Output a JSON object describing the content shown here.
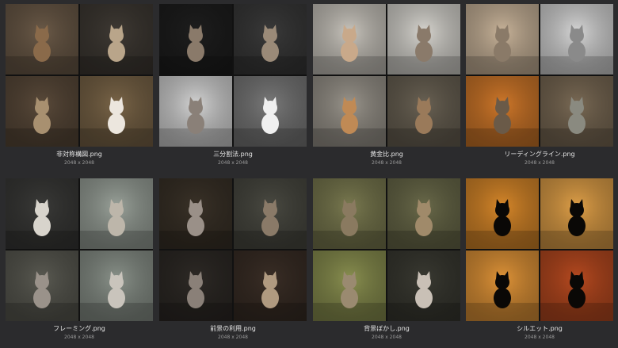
{
  "gallery": {
    "items": [
      {
        "name": "非対称構図.png",
        "dims": "2048 x 2048",
        "palette": [
          "#6b5a48",
          "#3f3a34",
          "#5a4a3a",
          "#7a6548"
        ],
        "cat": [
          "#8a6a4a",
          "#b9a58a",
          "#a89070",
          "#ece6de"
        ]
      },
      {
        "name": "三分割法.png",
        "dims": "2048 x 2048",
        "palette": [
          "#1e1e1e",
          "#3a3a3a",
          "#d4d4d4",
          "#7a7a7a"
        ],
        "cat": [
          "#8a7a6a",
          "#9a8a78",
          "#8a8078",
          "#f0f0f0"
        ]
      },
      {
        "name": "黄金比.png",
        "dims": "2048 x 2048",
        "palette": [
          "#c9c5bd",
          "#d8d6d0",
          "#9a958c",
          "#6a6254"
        ],
        "cat": [
          "#c9a98a",
          "#8a7a6a",
          "#c08a55",
          "#9a7a5a"
        ]
      },
      {
        "name": "リーディングライン.png",
        "dims": "2048 x 2048",
        "palette": [
          "#c9b49a",
          "#d7d7d7",
          "#d0782a",
          "#7a6a55"
        ],
        "cat": [
          "#8a7a68",
          "#8a8a8a",
          "#6a5a48",
          "#8a8a80"
        ]
      },
      {
        "name": "フレーミング.png",
        "dims": "2048 x 2048",
        "palette": [
          "#3a3a38",
          "#9aa29a",
          "#5a5a52",
          "#8a928a"
        ],
        "cat": [
          "#d8d4cc",
          "#bdb6aa",
          "#9a928a",
          "#c9c4bc"
        ]
      },
      {
        "name": "前景の利用.png",
        "dims": "2048 x 2048",
        "palette": [
          "#3a3228",
          "#4a4a42",
          "#2e2a26",
          "#3a2e26"
        ],
        "cat": [
          "#9a9088",
          "#8a7a68",
          "#8a8078",
          "#b09a80"
        ]
      },
      {
        "name": "背景ぼかし.png",
        "dims": "2048 x 2048",
        "palette": [
          "#7a7a50",
          "#6a6a4a",
          "#8a9050",
          "#3a3a32"
        ],
        "cat": [
          "#8a7a60",
          "#a08a6a",
          "#9a8a70",
          "#c9c0b6"
        ]
      },
      {
        "name": "シルエット.png",
        "dims": "2048 x 2048",
        "palette": [
          "#d8882a",
          "#e0a048",
          "#e09438",
          "#b84a20"
        ],
        "cat": [
          "#0a0806",
          "#0a0806",
          "#0a0806",
          "#0a0806"
        ]
      }
    ]
  }
}
